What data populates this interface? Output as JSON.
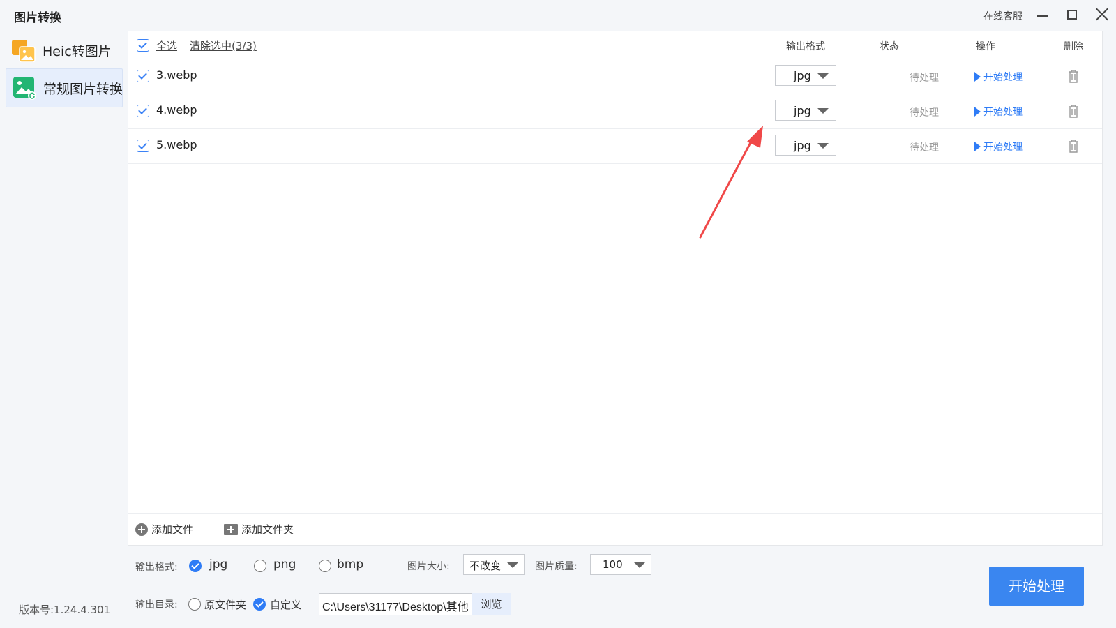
{
  "window": {
    "title": "图片转换",
    "support_label": "在线客服"
  },
  "sidebar": {
    "items": [
      {
        "label": "Heic转图片",
        "icon": "heic-image-icon"
      },
      {
        "label": "常规图片转换",
        "icon": "image-convert-icon"
      }
    ],
    "version": "版本号:1.24.4.301"
  },
  "file_list": {
    "select_all_label": "全选",
    "clear_selection_label": "清除选中(3/3)",
    "columns": {
      "format": "输出格式",
      "status": "状态",
      "action": "操作",
      "delete": "删除"
    },
    "rows": [
      {
        "name": "3.webp",
        "format": "jpg",
        "status": "待处理",
        "action": "开始处理"
      },
      {
        "name": "4.webp",
        "format": "jpg",
        "status": "待处理",
        "action": "开始处理"
      },
      {
        "name": "5.webp",
        "format": "jpg",
        "status": "待处理",
        "action": "开始处理"
      }
    ],
    "add_file_label": "添加文件",
    "add_folder_label": "添加文件夹"
  },
  "options": {
    "output_format_label": "输出格式:",
    "formats": [
      {
        "label": "jpg",
        "selected": true
      },
      {
        "label": "png",
        "selected": false
      },
      {
        "label": "bmp",
        "selected": false
      }
    ],
    "image_size_label": "图片大小:",
    "image_size_value": "不改变",
    "image_quality_label": "图片质量:",
    "image_quality_value": "100",
    "output_dir_label": "输出目录:",
    "dir_options": [
      {
        "label": "原文件夹",
        "selected": false
      },
      {
        "label": "自定义",
        "selected": true
      }
    ],
    "output_path": "C:\\Users\\31177\\Desktop\\其他",
    "browse_label": "浏览",
    "start_button_label": "开始处理"
  },
  "colors": {
    "accent": "#2f7cf6",
    "primary_button": "#3a86f0",
    "annotation_arrow": "#f04848"
  }
}
